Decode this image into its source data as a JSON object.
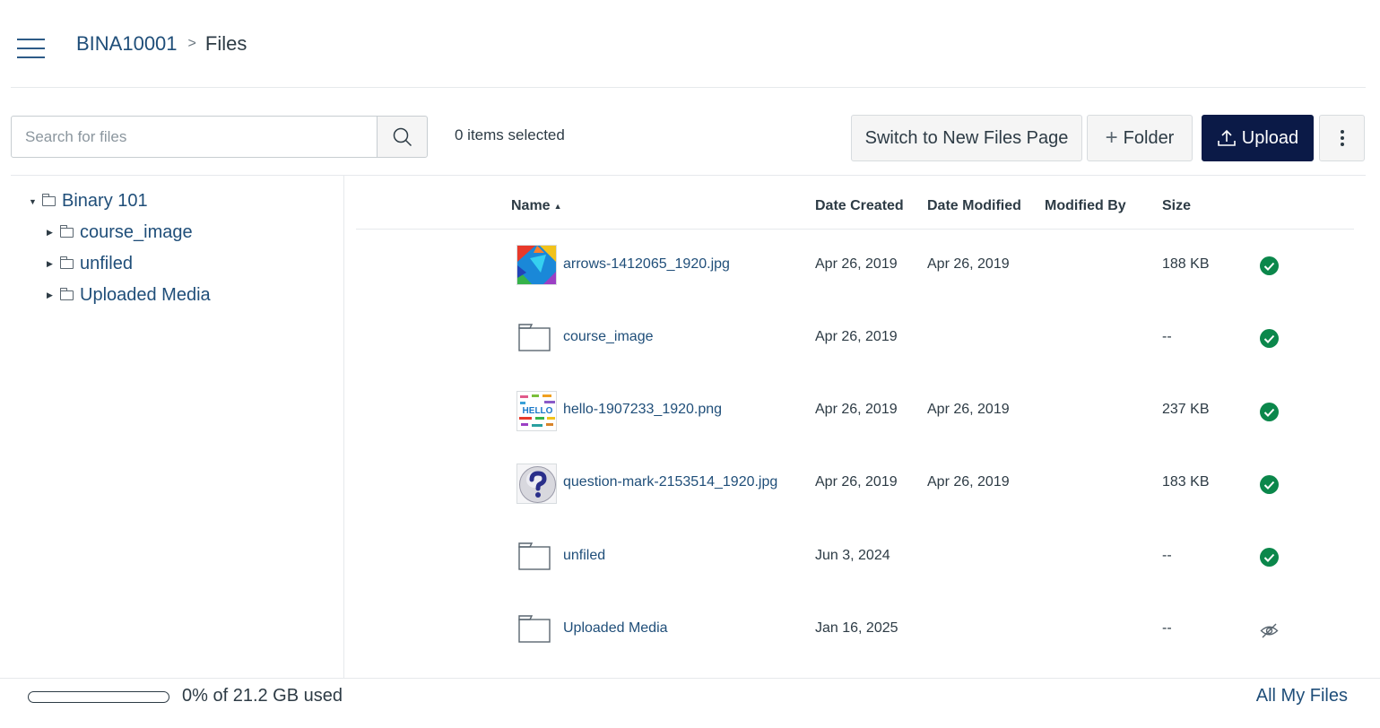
{
  "header": {
    "course": "BINA10001",
    "separator": ">",
    "current": "Files"
  },
  "toolbar": {
    "search_placeholder": "Search for files",
    "items_selected": "0 items selected",
    "switch_label": "Switch to New Files Page",
    "folder_plus": "+",
    "folder_label": "Folder",
    "upload_label": "Upload",
    "upload_color": "#0b1a47"
  },
  "tree": {
    "root": "Binary 101",
    "children": [
      "course_image",
      "unfiled",
      "Uploaded Media"
    ]
  },
  "table": {
    "columns": {
      "name": "Name",
      "date_created": "Date Created",
      "date_modified": "Date Modified",
      "modified_by": "Modified By",
      "size": "Size"
    },
    "rows": [
      {
        "name": "arrows-1412065_1920.jpg",
        "kind": "image",
        "created": "Apr 26, 2019",
        "modified": "Apr 26, 2019",
        "size": "188 KB",
        "status": "published"
      },
      {
        "name": "course_image",
        "kind": "folder",
        "created": "Apr 26, 2019",
        "modified": "",
        "size": "--",
        "status": "published"
      },
      {
        "name": "hello-1907233_1920.png",
        "kind": "image",
        "created": "Apr 26, 2019",
        "modified": "Apr 26, 2019",
        "size": "237 KB",
        "status": "published"
      },
      {
        "name": "question-mark-2153514_1920.jpg",
        "kind": "image",
        "created": "Apr 26, 2019",
        "modified": "Apr 26, 2019",
        "size": "183 KB",
        "status": "published"
      },
      {
        "name": "unfiled",
        "kind": "folder",
        "created": "Jun 3, 2024",
        "modified": "",
        "size": "--",
        "status": "published"
      },
      {
        "name": "Uploaded Media",
        "kind": "folder",
        "created": "Jan 16, 2025",
        "modified": "",
        "size": "--",
        "status": "hidden"
      }
    ],
    "thumb_hello_text": "HELLO",
    "published_color": "#0b874b"
  },
  "footer": {
    "quota": "0% of 21.2 GB used",
    "quota_fraction": 0,
    "all_files": "All My Files"
  },
  "icons": {
    "menu": "hamburger-icon",
    "search": "search-icon",
    "upload": "upload-icon",
    "more": "kebab-icon",
    "folder": "folder-icon",
    "published": "check-circle-icon",
    "hidden": "eye-slash-icon"
  }
}
